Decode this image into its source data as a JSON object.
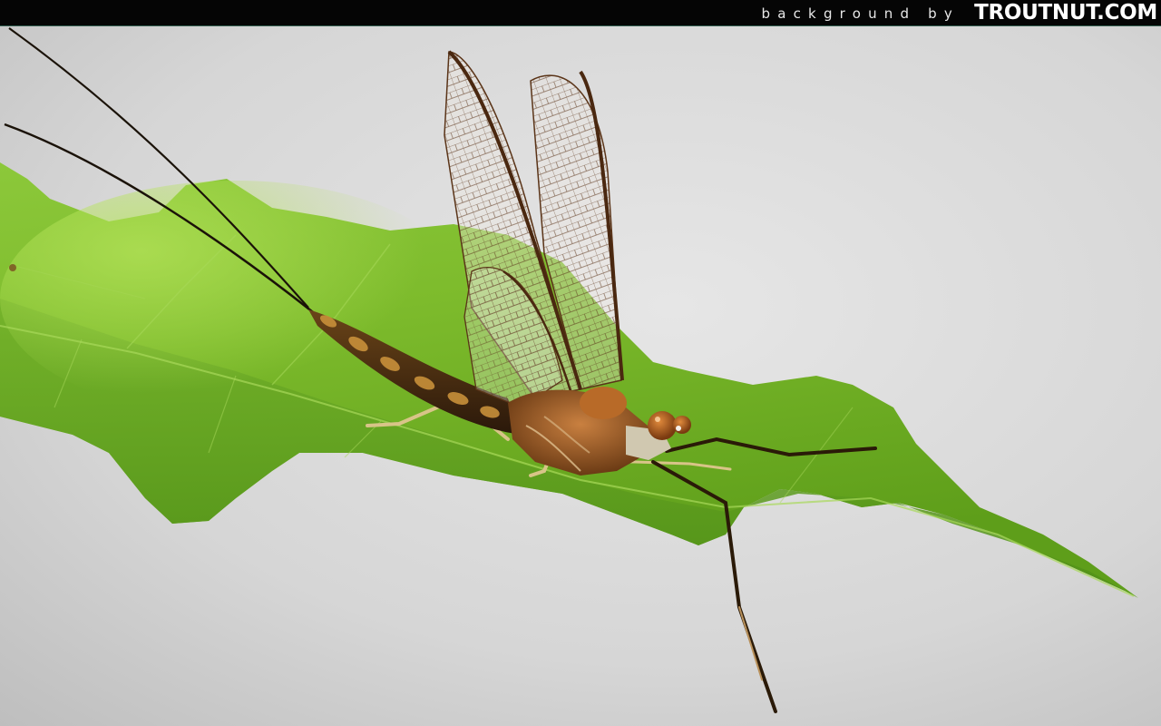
{
  "header": {
    "credit_text": "background by",
    "brand": "TROUTNUT.COM"
  },
  "photo": {
    "subject": "mayfly-on-leaf",
    "colors": {
      "background_light": "#e4e4e4",
      "background_dark": "#bfbfbf",
      "leaf_bright": "#9ad43a",
      "leaf_dark": "#4f8f17",
      "body_dark": "#3a2210",
      "body_orange": "#b86a28",
      "wing_vein": "#5a3418"
    }
  }
}
